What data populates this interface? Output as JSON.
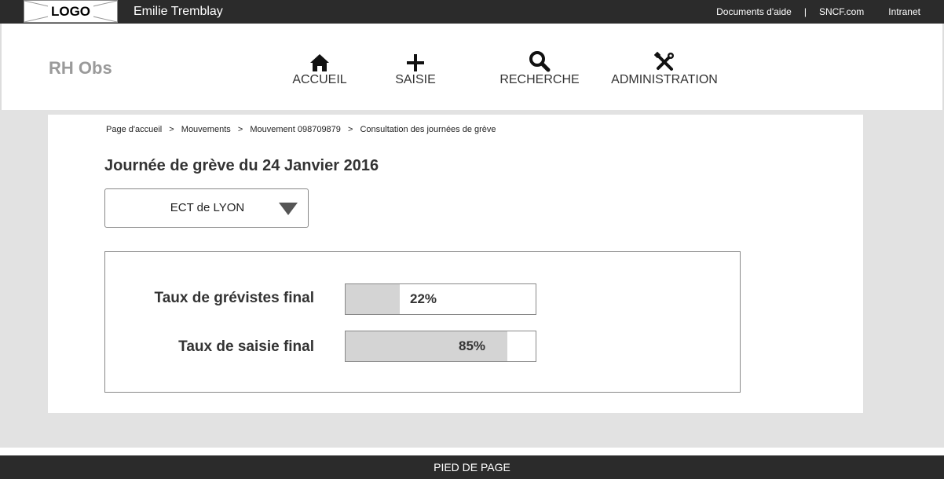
{
  "topbar": {
    "logo_text": "LOGO",
    "user_name": "Emilie Tremblay",
    "links": {
      "help": "Documents d'aide",
      "separator": "|",
      "sncf": "SNCF.com",
      "intranet": "Intranet"
    }
  },
  "header": {
    "app_title": "RH Obs",
    "nav": {
      "home": {
        "label": "ACCUEIL",
        "icon": "home-icon"
      },
      "entry": {
        "label": "SAISIE",
        "icon": "plus-icon"
      },
      "search": {
        "label": "RECHERCHE",
        "icon": "search-icon"
      },
      "admin": {
        "label": "ADMINISTRATION",
        "icon": "tools-icon"
      }
    }
  },
  "breadcrumb": {
    "items": [
      "Page d'accueil",
      "Mouvements",
      "Mouvement 098709879",
      "Consultation des journées de grève"
    ],
    "separator": ">"
  },
  "page": {
    "title": "Journée de grève du 24 Janvier 2016",
    "select_value": "ECT de LYON"
  },
  "stats": {
    "strikers": {
      "label": "Taux de grévistes final",
      "value_text": "22%",
      "fraction": 0.22
    },
    "entry": {
      "label": "Taux de saisie final",
      "value_text": "85%",
      "fraction": 0.85
    }
  },
  "footer": {
    "label": "PIED DE PAGE"
  },
  "colors": {
    "bar_dark": "#2b2b2b",
    "background_grey": "#e2e2e2",
    "progress_fill": "#d4d4d4",
    "app_title": "#9a9a9a"
  }
}
